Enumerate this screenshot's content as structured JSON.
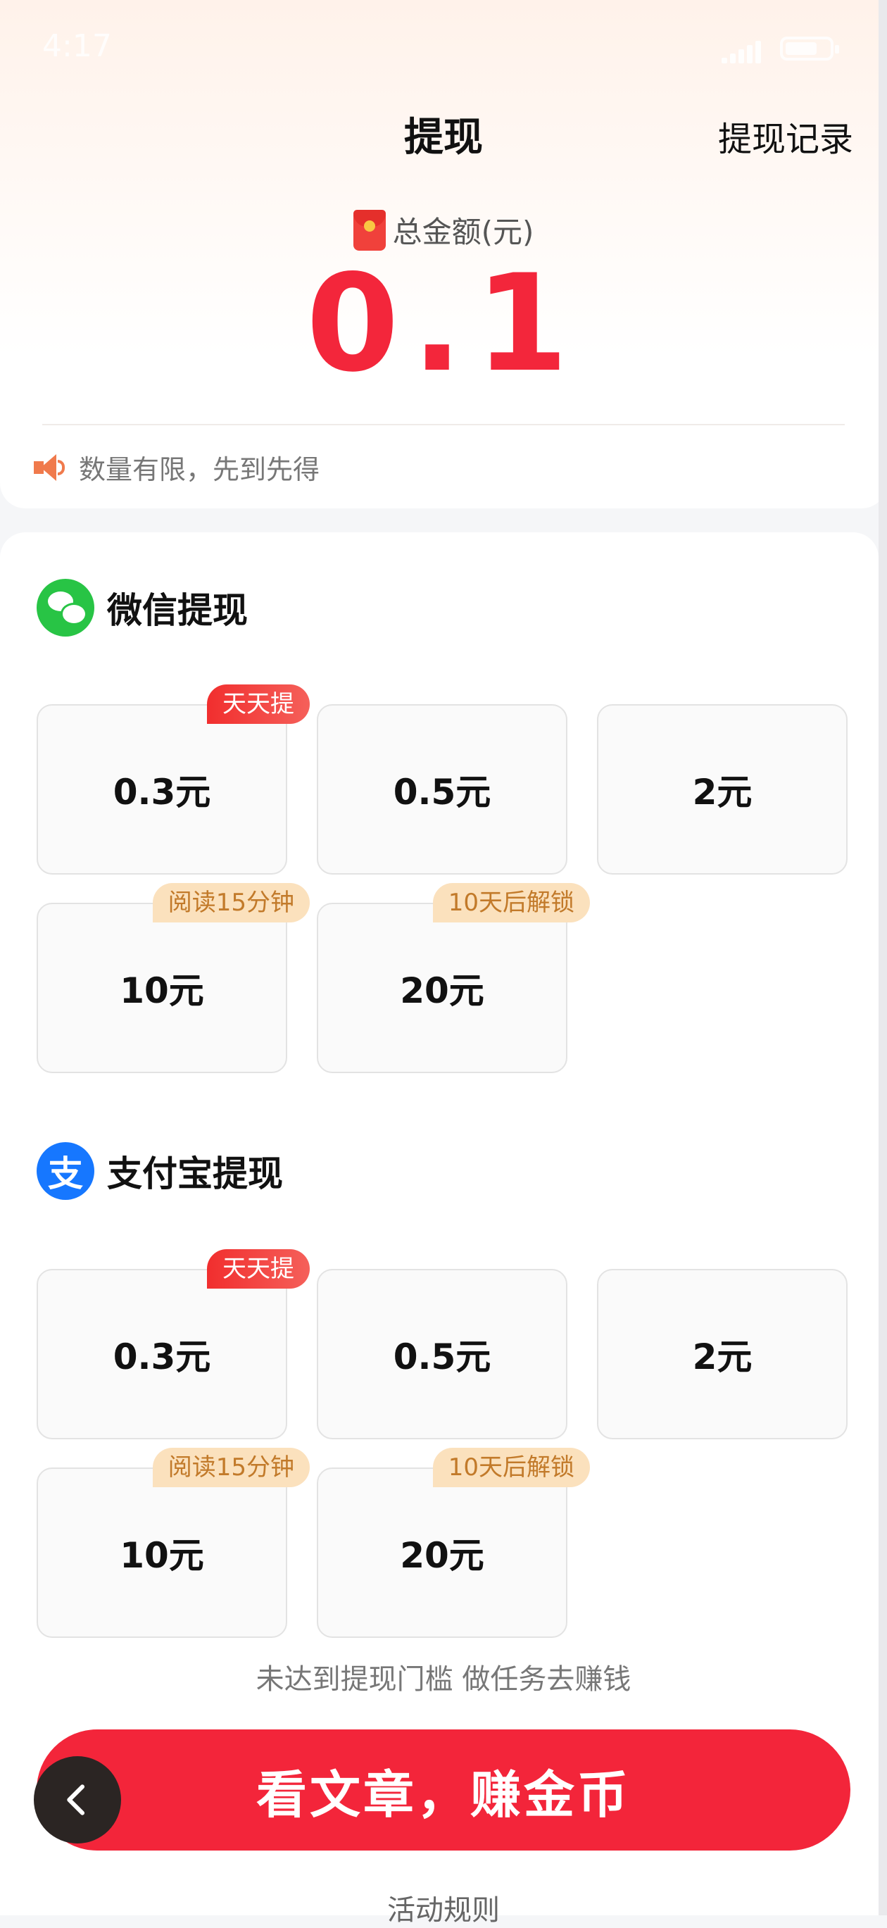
{
  "status_bar": {
    "time": "4:17"
  },
  "header": {
    "title": "提现",
    "history": "提现记录"
  },
  "balance": {
    "label": "总金额(元)",
    "amount": "0.1"
  },
  "notice": "数量有限，先到先得",
  "wechat": {
    "title": "微信提现",
    "icon": "wechat-icon",
    "options": [
      {
        "label": "0.3元",
        "tag": "天天提"
      },
      {
        "label": "0.5元",
        "tag": ""
      },
      {
        "label": "2元",
        "tag": ""
      },
      {
        "label": "10元",
        "tag": "阅读15分钟"
      },
      {
        "label": "20元",
        "tag": "10天后解锁"
      }
    ]
  },
  "alipay": {
    "title": "支付宝提现",
    "icon": "alipay-icon",
    "icon_glyph": "支",
    "options": [
      {
        "label": "0.3元",
        "tag": "天天提"
      },
      {
        "label": "0.5元",
        "tag": ""
      },
      {
        "label": "2元",
        "tag": ""
      },
      {
        "label": "10元",
        "tag": "阅读15分钟"
      },
      {
        "label": "20元",
        "tag": "10天后解锁"
      }
    ]
  },
  "hint": "未达到提现门槛 做任务去赚钱",
  "cta": "看文章，赚金币",
  "rules": "活动规则",
  "colors": {
    "accent_red": "#f3253a",
    "wechat_green": "#28c445",
    "alipay_blue": "#1677ff",
    "tag_orange_bg": "#fbe1bd"
  }
}
